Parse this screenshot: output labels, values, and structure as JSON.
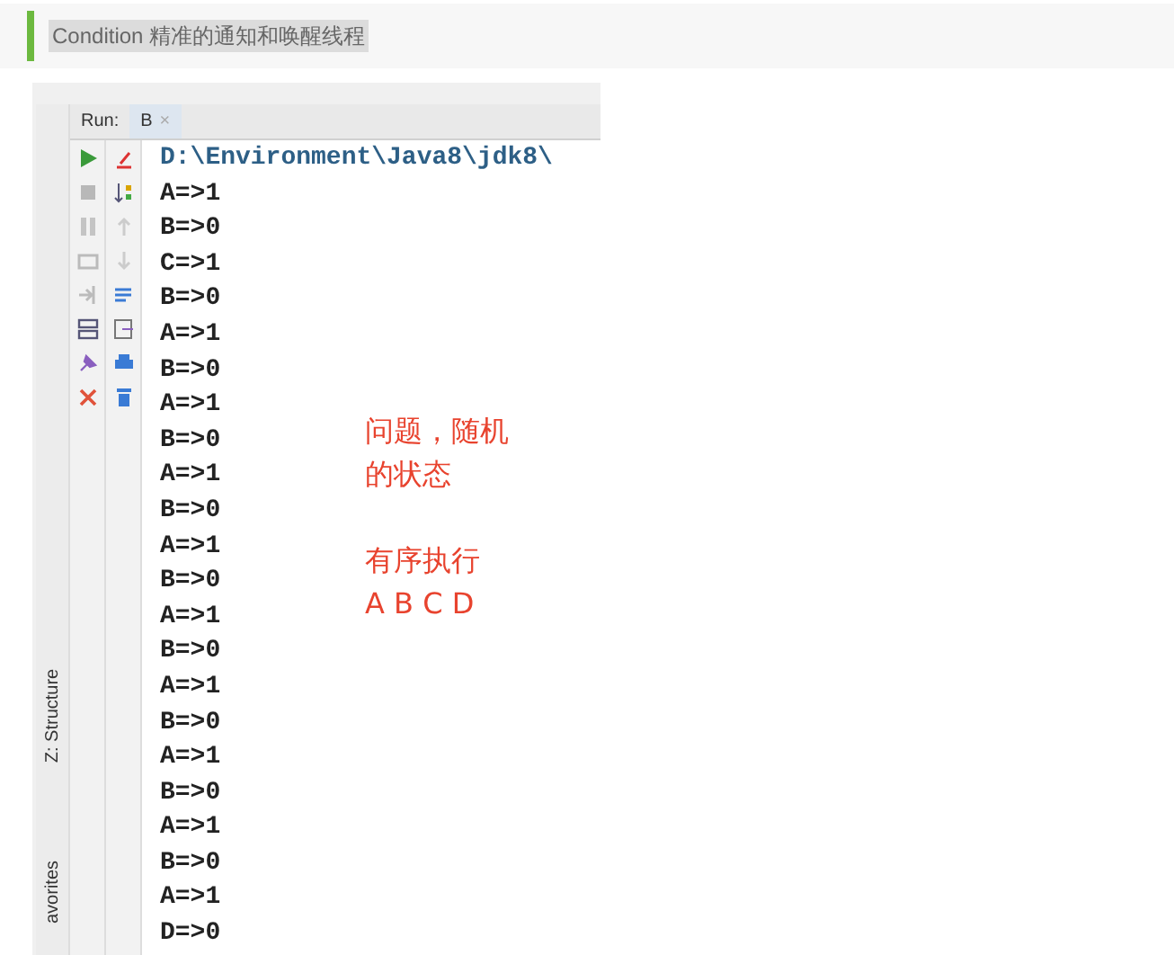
{
  "heading": "Condition 精准的通知和唤醒线程",
  "run_panel": {
    "run_label": "Run:",
    "tabs": [
      {
        "label": "B",
        "selected": true,
        "close": "×"
      }
    ]
  },
  "side_tabs": [
    {
      "label": "Z: Structure"
    },
    {
      "label": "avorites"
    }
  ],
  "console_lines": [
    "D:\\Environment\\Java8\\jdk8\\",
    "A=>1",
    "B=>0",
    "C=>1",
    "B=>0",
    "A=>1",
    "B=>0",
    "A=>1",
    "B=>0",
    "A=>1",
    "B=>0",
    "A=>1",
    "B=>0",
    "A=>1",
    "B=>0",
    "A=>1",
    "B=>0",
    "A=>1",
    "B=>0",
    "A=>1",
    "B=>0",
    "A=>1",
    "D=>0"
  ],
  "annotation": [
    "问题，随机",
    "的状态",
    "有序执行",
    "A B C D"
  ]
}
